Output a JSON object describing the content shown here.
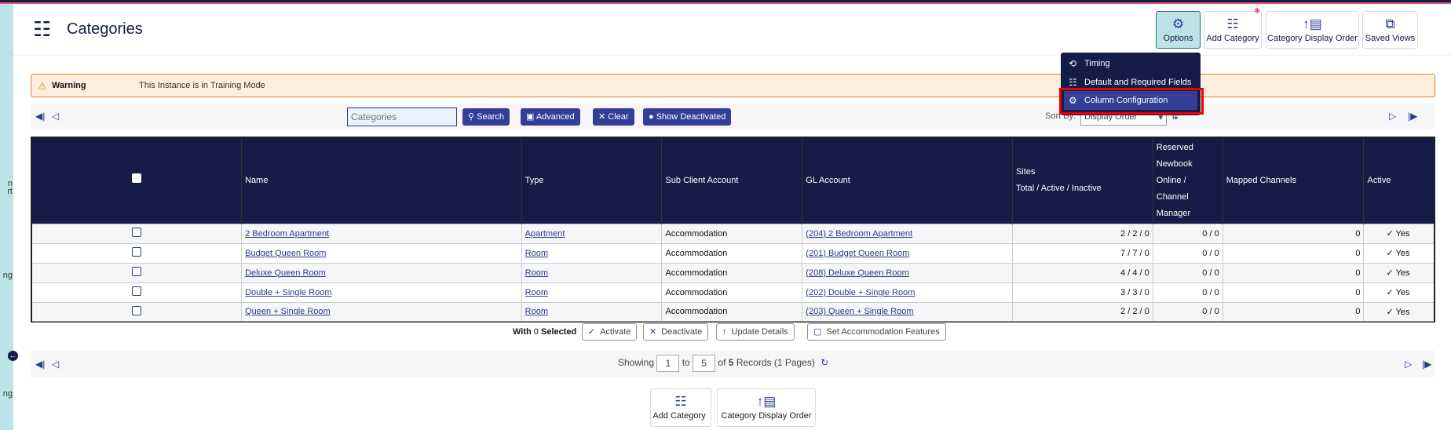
{
  "page": {
    "title": "Categories",
    "title_icon": "category-tree-icon"
  },
  "sidebar": {
    "fragments": [
      "n",
      "rt",
      "ng",
      "ng"
    ]
  },
  "header_buttons": [
    {
      "label": "Options",
      "icon": "gear-icon"
    },
    {
      "label": "Add Category",
      "icon": "category-tree-icon"
    },
    {
      "label": "Category Display Order",
      "icon": "sort-order-icon"
    },
    {
      "label": "Saved Views",
      "icon": "windows-icon"
    }
  ],
  "options_menu": [
    {
      "label": "Timing",
      "icon": "history-icon"
    },
    {
      "label": "Default and Required Fields",
      "icon": "sitemap-icon"
    },
    {
      "label": "Column Configuration",
      "icon": "gear-icon",
      "highlighted": true
    }
  ],
  "warning": {
    "label": "Warning",
    "message": "This Instance is in Training Mode"
  },
  "toolbar": {
    "search_placeholder": "Categories",
    "search": "Search",
    "advanced": "Advanced",
    "clear": "Clear",
    "show_deactivated": "Show Deactivated",
    "sort_label": "Sort By:",
    "sort_value": "Display Order"
  },
  "table": {
    "columns": [
      "Name",
      "Type",
      "Sub Client Account",
      "GL Account",
      "Sites",
      "Total / Active / Inactive",
      "Reserved Newbook Online / Channel Manager",
      "Mapped Channels",
      "Active"
    ],
    "rows": [
      {
        "name": "2 Bedroom Apartment",
        "type": "Apartment",
        "sub": "Accommodation",
        "gl": "(204) 2 Bedroom Apartment",
        "sites": "2 / 2 / 0",
        "reserved": "0 / 0",
        "mapped": "0",
        "active": "Yes"
      },
      {
        "name": "Budget Queen Room",
        "type": "Room",
        "sub": "Accommodation",
        "gl": "(201) Budget Queen Room",
        "sites": "7 / 7 / 0",
        "reserved": "0 / 0",
        "mapped": "0",
        "active": "Yes"
      },
      {
        "name": "Deluxe Queen Room",
        "type": "Room",
        "sub": "Accommodation",
        "gl": "(208) Deluxe Queen Room",
        "sites": "4 / 4 / 0",
        "reserved": "0 / 0",
        "mapped": "0",
        "active": "Yes"
      },
      {
        "name": "Double + Single Room",
        "type": "Room",
        "sub": "Accommodation",
        "gl": "(202) Double + Single Room",
        "sites": "3 / 3 / 0",
        "reserved": "0 / 0",
        "mapped": "0",
        "active": "Yes"
      },
      {
        "name": "Queen + Single Room",
        "type": "Room",
        "sub": "Accommodation",
        "gl": "(203) Queen + Single Room",
        "sites": "2 / 2 / 0",
        "reserved": "0 / 0",
        "mapped": "0",
        "active": "Yes"
      }
    ]
  },
  "bulk": {
    "with": "With",
    "count": "0",
    "selected": "Selected",
    "activate": "Activate",
    "deactivate": "Deactivate",
    "update": "Update Details",
    "features": "Set Accommodation Features"
  },
  "pager": {
    "showing": "Showing",
    "from": "1",
    "to_label": "to",
    "to": "5",
    "of": "of",
    "total": "5",
    "records": "Records (1 Pages)"
  },
  "bottom_buttons": [
    {
      "label": "Add Category"
    },
    {
      "label": "Category Display Order"
    }
  ]
}
